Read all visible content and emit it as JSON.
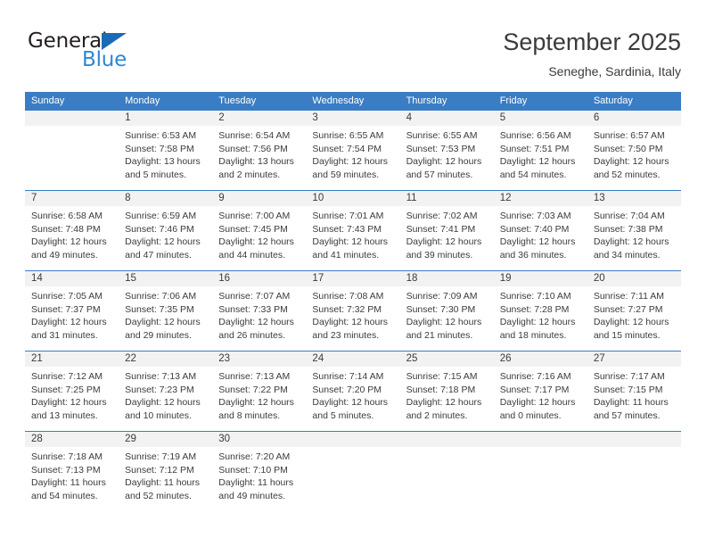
{
  "logo": {
    "word_top": "General",
    "word_bottom": "Blue",
    "triangle_color": "#1a6bb5",
    "blue_color": "#2e87d6"
  },
  "header": {
    "title": "September 2025",
    "subtitle": "Seneghe, Sardinia, Italy"
  },
  "theme": {
    "header_bg": "#3b7dc4",
    "day_num_bg": "#f2f2f2",
    "text": "#3b3b3b"
  },
  "weekdays": [
    "Sunday",
    "Monday",
    "Tuesday",
    "Wednesday",
    "Thursday",
    "Friday",
    "Saturday"
  ],
  "weeks": [
    [
      {
        "day": "",
        "lines": []
      },
      {
        "day": "1",
        "lines": [
          "Sunrise: 6:53 AM",
          "Sunset: 7:58 PM",
          "Daylight: 13 hours",
          "and 5 minutes."
        ]
      },
      {
        "day": "2",
        "lines": [
          "Sunrise: 6:54 AM",
          "Sunset: 7:56 PM",
          "Daylight: 13 hours",
          "and 2 minutes."
        ]
      },
      {
        "day": "3",
        "lines": [
          "Sunrise: 6:55 AM",
          "Sunset: 7:54 PM",
          "Daylight: 12 hours",
          "and 59 minutes."
        ]
      },
      {
        "day": "4",
        "lines": [
          "Sunrise: 6:55 AM",
          "Sunset: 7:53 PM",
          "Daylight: 12 hours",
          "and 57 minutes."
        ]
      },
      {
        "day": "5",
        "lines": [
          "Sunrise: 6:56 AM",
          "Sunset: 7:51 PM",
          "Daylight: 12 hours",
          "and 54 minutes."
        ]
      },
      {
        "day": "6",
        "lines": [
          "Sunrise: 6:57 AM",
          "Sunset: 7:50 PM",
          "Daylight: 12 hours",
          "and 52 minutes."
        ]
      }
    ],
    [
      {
        "day": "7",
        "lines": [
          "Sunrise: 6:58 AM",
          "Sunset: 7:48 PM",
          "Daylight: 12 hours",
          "and 49 minutes."
        ]
      },
      {
        "day": "8",
        "lines": [
          "Sunrise: 6:59 AM",
          "Sunset: 7:46 PM",
          "Daylight: 12 hours",
          "and 47 minutes."
        ]
      },
      {
        "day": "9",
        "lines": [
          "Sunrise: 7:00 AM",
          "Sunset: 7:45 PM",
          "Daylight: 12 hours",
          "and 44 minutes."
        ]
      },
      {
        "day": "10",
        "lines": [
          "Sunrise: 7:01 AM",
          "Sunset: 7:43 PM",
          "Daylight: 12 hours",
          "and 41 minutes."
        ]
      },
      {
        "day": "11",
        "lines": [
          "Sunrise: 7:02 AM",
          "Sunset: 7:41 PM",
          "Daylight: 12 hours",
          "and 39 minutes."
        ]
      },
      {
        "day": "12",
        "lines": [
          "Sunrise: 7:03 AM",
          "Sunset: 7:40 PM",
          "Daylight: 12 hours",
          "and 36 minutes."
        ]
      },
      {
        "day": "13",
        "lines": [
          "Sunrise: 7:04 AM",
          "Sunset: 7:38 PM",
          "Daylight: 12 hours",
          "and 34 minutes."
        ]
      }
    ],
    [
      {
        "day": "14",
        "lines": [
          "Sunrise: 7:05 AM",
          "Sunset: 7:37 PM",
          "Daylight: 12 hours",
          "and 31 minutes."
        ]
      },
      {
        "day": "15",
        "lines": [
          "Sunrise: 7:06 AM",
          "Sunset: 7:35 PM",
          "Daylight: 12 hours",
          "and 29 minutes."
        ]
      },
      {
        "day": "16",
        "lines": [
          "Sunrise: 7:07 AM",
          "Sunset: 7:33 PM",
          "Daylight: 12 hours",
          "and 26 minutes."
        ]
      },
      {
        "day": "17",
        "lines": [
          "Sunrise: 7:08 AM",
          "Sunset: 7:32 PM",
          "Daylight: 12 hours",
          "and 23 minutes."
        ]
      },
      {
        "day": "18",
        "lines": [
          "Sunrise: 7:09 AM",
          "Sunset: 7:30 PM",
          "Daylight: 12 hours",
          "and 21 minutes."
        ]
      },
      {
        "day": "19",
        "lines": [
          "Sunrise: 7:10 AM",
          "Sunset: 7:28 PM",
          "Daylight: 12 hours",
          "and 18 minutes."
        ]
      },
      {
        "day": "20",
        "lines": [
          "Sunrise: 7:11 AM",
          "Sunset: 7:27 PM",
          "Daylight: 12 hours",
          "and 15 minutes."
        ]
      }
    ],
    [
      {
        "day": "21",
        "lines": [
          "Sunrise: 7:12 AM",
          "Sunset: 7:25 PM",
          "Daylight: 12 hours",
          "and 13 minutes."
        ]
      },
      {
        "day": "22",
        "lines": [
          "Sunrise: 7:13 AM",
          "Sunset: 7:23 PM",
          "Daylight: 12 hours",
          "and 10 minutes."
        ]
      },
      {
        "day": "23",
        "lines": [
          "Sunrise: 7:13 AM",
          "Sunset: 7:22 PM",
          "Daylight: 12 hours",
          "and 8 minutes."
        ]
      },
      {
        "day": "24",
        "lines": [
          "Sunrise: 7:14 AM",
          "Sunset: 7:20 PM",
          "Daylight: 12 hours",
          "and 5 minutes."
        ]
      },
      {
        "day": "25",
        "lines": [
          "Sunrise: 7:15 AM",
          "Sunset: 7:18 PM",
          "Daylight: 12 hours",
          "and 2 minutes."
        ]
      },
      {
        "day": "26",
        "lines": [
          "Sunrise: 7:16 AM",
          "Sunset: 7:17 PM",
          "Daylight: 12 hours",
          "and 0 minutes."
        ]
      },
      {
        "day": "27",
        "lines": [
          "Sunrise: 7:17 AM",
          "Sunset: 7:15 PM",
          "Daylight: 11 hours",
          "and 57 minutes."
        ]
      }
    ],
    [
      {
        "day": "28",
        "lines": [
          "Sunrise: 7:18 AM",
          "Sunset: 7:13 PM",
          "Daylight: 11 hours",
          "and 54 minutes."
        ]
      },
      {
        "day": "29",
        "lines": [
          "Sunrise: 7:19 AM",
          "Sunset: 7:12 PM",
          "Daylight: 11 hours",
          "and 52 minutes."
        ]
      },
      {
        "day": "30",
        "lines": [
          "Sunrise: 7:20 AM",
          "Sunset: 7:10 PM",
          "Daylight: 11 hours",
          "and 49 minutes."
        ]
      },
      {
        "day": "",
        "lines": []
      },
      {
        "day": "",
        "lines": []
      },
      {
        "day": "",
        "lines": []
      },
      {
        "day": "",
        "lines": []
      }
    ]
  ]
}
